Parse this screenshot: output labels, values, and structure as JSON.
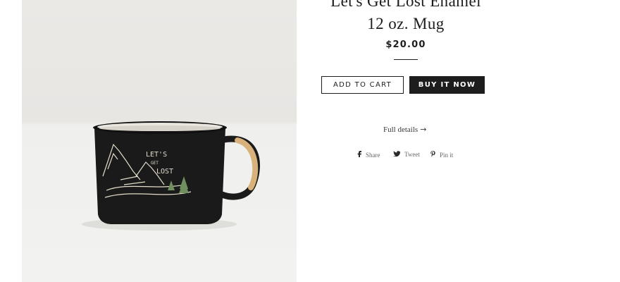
{
  "product": {
    "title_line1": "Let's Get Lost Enamel",
    "title_line2": "12 oz. Mug",
    "price": "$20.00",
    "mug_print": {
      "line1": "LET'S",
      "line2": "GET",
      "line3": "LOST"
    }
  },
  "actions": {
    "add_to_cart": "ADD TO CART",
    "buy_now": "BUY IT NOW",
    "full_details": "Full details",
    "full_details_arrow": "→"
  },
  "share": {
    "facebook": {
      "label": "Share",
      "icon": "facebook-icon"
    },
    "twitter": {
      "label": "Tweet",
      "icon": "twitter-icon"
    },
    "pinterest": {
      "label": "Pin it",
      "icon": "pinterest-icon"
    }
  },
  "colors": {
    "text": "#1d1d1d",
    "button_dark": "#1d1d1d",
    "mug_black": "#1a1a1a",
    "handle_tape": "#d8b27a",
    "tree_green": "#6f8f5e"
  }
}
